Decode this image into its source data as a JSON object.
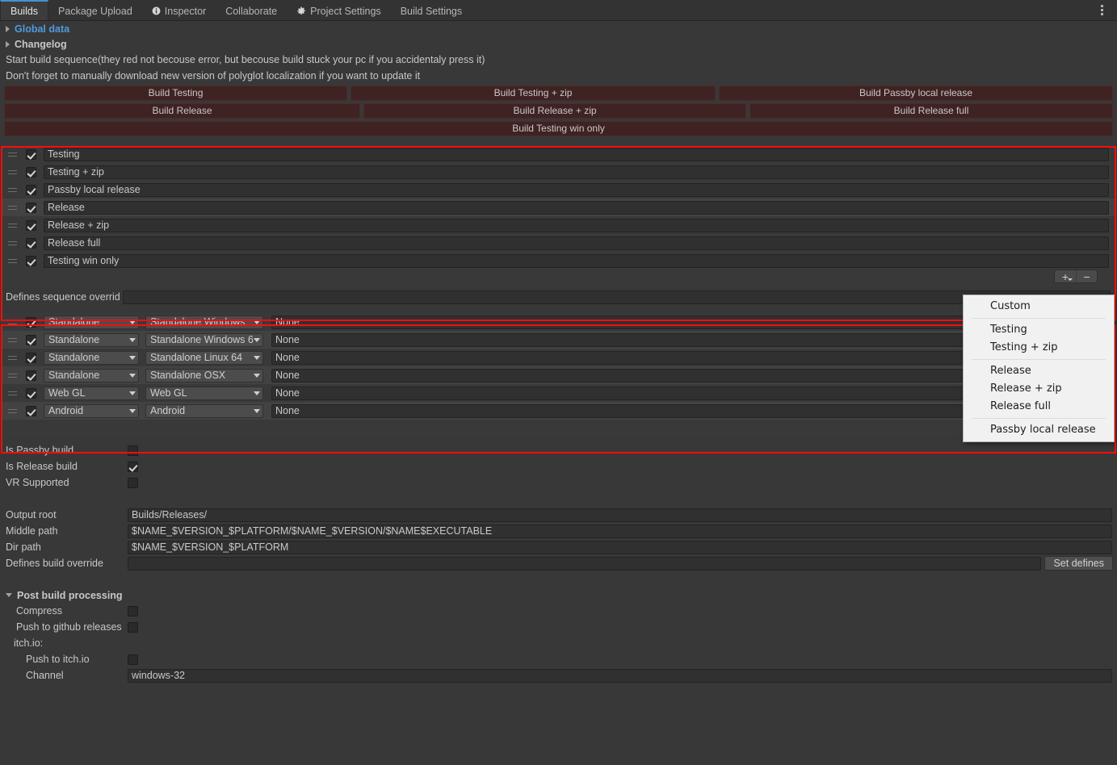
{
  "window": {
    "tabs": [
      {
        "label": "Builds",
        "icon": null,
        "active": true
      },
      {
        "label": "Package Upload",
        "icon": null,
        "active": false
      },
      {
        "label": "Inspector",
        "icon": "info-icon",
        "active": false
      },
      {
        "label": "Collaborate",
        "icon": null,
        "active": false
      },
      {
        "label": "Project Settings",
        "icon": "gear-icon",
        "active": false
      },
      {
        "label": "Build Settings",
        "icon": null,
        "active": false
      }
    ],
    "menu_icon": "kebab-menu-icon"
  },
  "foldouts": {
    "global_data": "Global data",
    "changelog": "Changelog",
    "post_build": "Post build processing"
  },
  "notes": {
    "line1": "Start build sequence(they red not becouse error, but becouse build stuck your pc if you accidentaly press it)",
    "line2": "Don't forget to manually download new version of polyglot localization if you want to update it"
  },
  "build_buttons": {
    "row1": [
      "Build Testing",
      "Build Testing + zip",
      "Build Passby local release"
    ],
    "row2": [
      "Build Release",
      "Build Release + zip",
      "Build Release full"
    ],
    "row3": [
      "Build Testing win only"
    ],
    "color": "#3f2222"
  },
  "sequence_list": {
    "items": [
      {
        "name": "Testing",
        "enabled": true
      },
      {
        "name": "Testing + zip",
        "enabled": true
      },
      {
        "name": "Passby local release",
        "enabled": true
      },
      {
        "name": "Release",
        "enabled": true
      },
      {
        "name": "Release + zip",
        "enabled": true
      },
      {
        "name": "Release full",
        "enabled": true
      },
      {
        "name": "Testing win only",
        "enabled": true
      }
    ],
    "add_label": "+",
    "remove_label": "−"
  },
  "defines_sequence_override": {
    "label": "Defines sequence overrid",
    "value": ""
  },
  "platform_list": {
    "columns": [
      "target-group",
      "build-target",
      "extra"
    ],
    "rows": [
      {
        "group": "Standalone",
        "target": "Standalone Windows",
        "extra": "None",
        "enabled": true
      },
      {
        "group": "Standalone",
        "target": "Standalone Windows 6",
        "extra": "None",
        "enabled": true
      },
      {
        "group": "Standalone",
        "target": "Standalone Linux 64",
        "extra": "None",
        "enabled": true
      },
      {
        "group": "Standalone",
        "target": "Standalone OSX",
        "extra": "None",
        "enabled": true
      },
      {
        "group": "Web GL",
        "target": "Web GL",
        "extra": "None",
        "enabled": true
      },
      {
        "group": "Android",
        "target": "Android",
        "extra": "None",
        "enabled": true
      }
    ],
    "add_label": "+",
    "remove_label": "−"
  },
  "flags": [
    {
      "label": "Is Passby build",
      "checked": false
    },
    {
      "label": "Is Release build",
      "checked": true
    },
    {
      "label": "VR Supported",
      "checked": false
    }
  ],
  "paths": [
    {
      "label": "Output root",
      "value": "Builds/Releases/"
    },
    {
      "label": "Middle path",
      "value": "$NAME_$VERSION_$PLATFORM/$NAME_$VERSION/$NAME$EXECUTABLE"
    },
    {
      "label": "Dir path",
      "value": "$NAME_$VERSION_$PLATFORM"
    }
  ],
  "defines_build_override": {
    "label": "Defines build override",
    "value": "",
    "button": "Set defines"
  },
  "post_build": {
    "compress": {
      "label": "Compress",
      "checked": false
    },
    "push_github": {
      "label": "Push to github releases",
      "checked": false
    },
    "itch_header": "itch.io:",
    "push_itch": {
      "label": "Push to itch.io",
      "checked": false
    },
    "channel": {
      "label": "Channel",
      "value": "windows-32"
    }
  },
  "context_menu": {
    "groups": [
      [
        "Custom"
      ],
      [
        "Testing",
        "Testing + zip"
      ],
      [
        "Release",
        "Release + zip",
        "Release full"
      ],
      [
        "Passby local release"
      ]
    ]
  },
  "highlight_color": "#ff0c0c"
}
